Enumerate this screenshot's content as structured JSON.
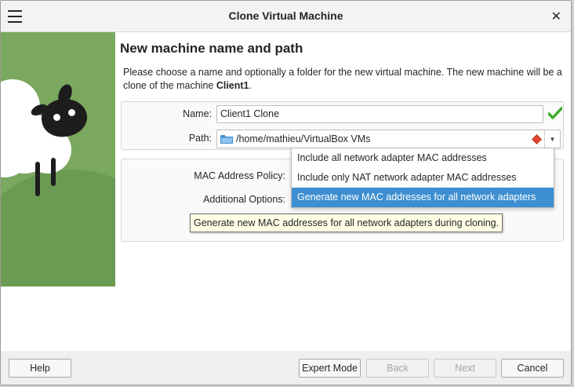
{
  "window": {
    "title": "Clone Virtual Machine"
  },
  "page": {
    "heading": "New machine name and path",
    "description_prefix": "Please choose a name and optionally a folder for the new virtual machine. The new machine will be a clone of the machine ",
    "source_machine": "Client1",
    "description_suffix": "."
  },
  "form": {
    "name_label": "Name:",
    "name_value": "Client1 Clone",
    "path_label": "Path:",
    "path_value": "/home/mathieu/VirtualBox VMs",
    "mac_policy_label": "MAC Address Policy:",
    "additional_options_label": "Additional Options:"
  },
  "mac_policy_options": [
    {
      "label": "Include all network adapter MAC addresses",
      "selected": false
    },
    {
      "label": "Include only NAT network adapter MAC addresses",
      "selected": false
    },
    {
      "label": "Generate new MAC addresses for all network adapters",
      "selected": true
    }
  ],
  "tooltip": "Generate new MAC addresses for all network adapters during cloning.",
  "buttons": {
    "help": "Help",
    "expert_mode": "Expert Mode",
    "back": "Back",
    "next": "Next",
    "cancel": "Cancel"
  },
  "colors": {
    "accent": "#3d8fd1",
    "art_green": "#7aa85f",
    "valid_check": "#3fae2a",
    "warning": "#e24a2f"
  }
}
